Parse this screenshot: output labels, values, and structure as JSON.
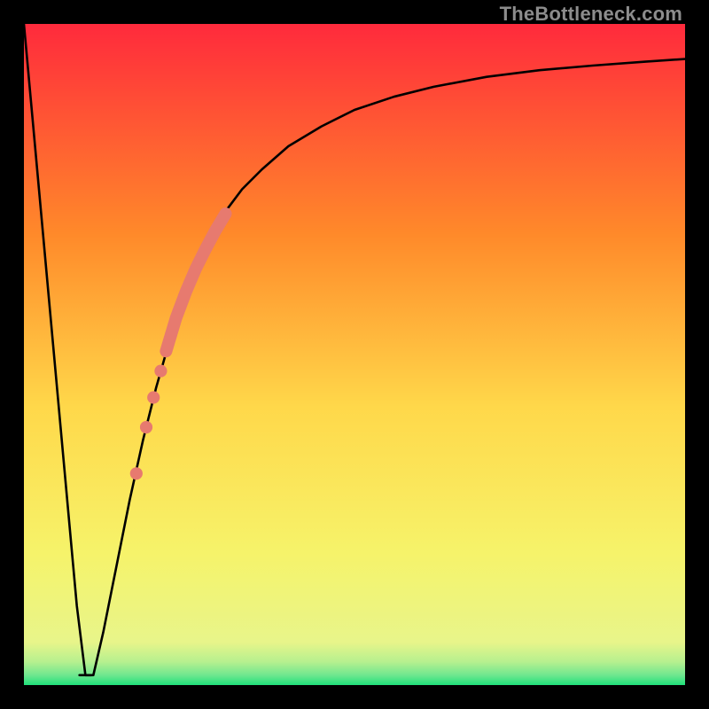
{
  "watermark": "TheBottleneck.com",
  "colors": {
    "gradient_top": "#ff2a3c",
    "gradient_mid1": "#ff8a2a",
    "gradient_mid2": "#ffd84a",
    "gradient_mid3": "#f6f36a",
    "gradient_low": "#e8f58a",
    "gradient_bottom": "#1fe07a",
    "curve": "#000000",
    "marker": "#e77a6f",
    "frame": "#000000"
  },
  "chart_data": {
    "type": "line",
    "title": "",
    "xlabel": "",
    "ylabel": "",
    "xlim": [
      0,
      100
    ],
    "ylim": [
      0,
      100
    ],
    "curve": {
      "x": [
        0,
        2,
        4,
        6,
        8,
        9.3,
        10.5,
        12,
        14,
        16,
        18,
        20,
        22,
        24,
        26,
        28,
        30,
        33,
        36,
        40,
        45,
        50,
        56,
        62,
        70,
        78,
        86,
        94,
        100
      ],
      "y": [
        100,
        78,
        56,
        34,
        12,
        1.5,
        1.5,
        8,
        18,
        28,
        37,
        45,
        52,
        58,
        63,
        67.5,
        71,
        75,
        78,
        81.5,
        84.5,
        87,
        89,
        90.5,
        92,
        93,
        93.7,
        94.3,
        94.7
      ]
    },
    "flat_min": {
      "x_start": 8.4,
      "x_end": 10.2,
      "y": 1.5
    },
    "markers": [
      {
        "x": 17.0,
        "y": 32.0,
        "r": 0.95
      },
      {
        "x": 18.5,
        "y": 39.0,
        "r": 0.95
      },
      {
        "x": 19.6,
        "y": 43.5,
        "r": 0.95
      },
      {
        "x": 20.7,
        "y": 47.5,
        "r": 0.95
      }
    ],
    "thick_segment": {
      "x": [
        21.5,
        23.0,
        24.5,
        26.0,
        27.5,
        29.0,
        30.5
      ],
      "y": [
        50.5,
        55.5,
        59.5,
        63.0,
        66.0,
        68.8,
        71.3
      ]
    }
  }
}
